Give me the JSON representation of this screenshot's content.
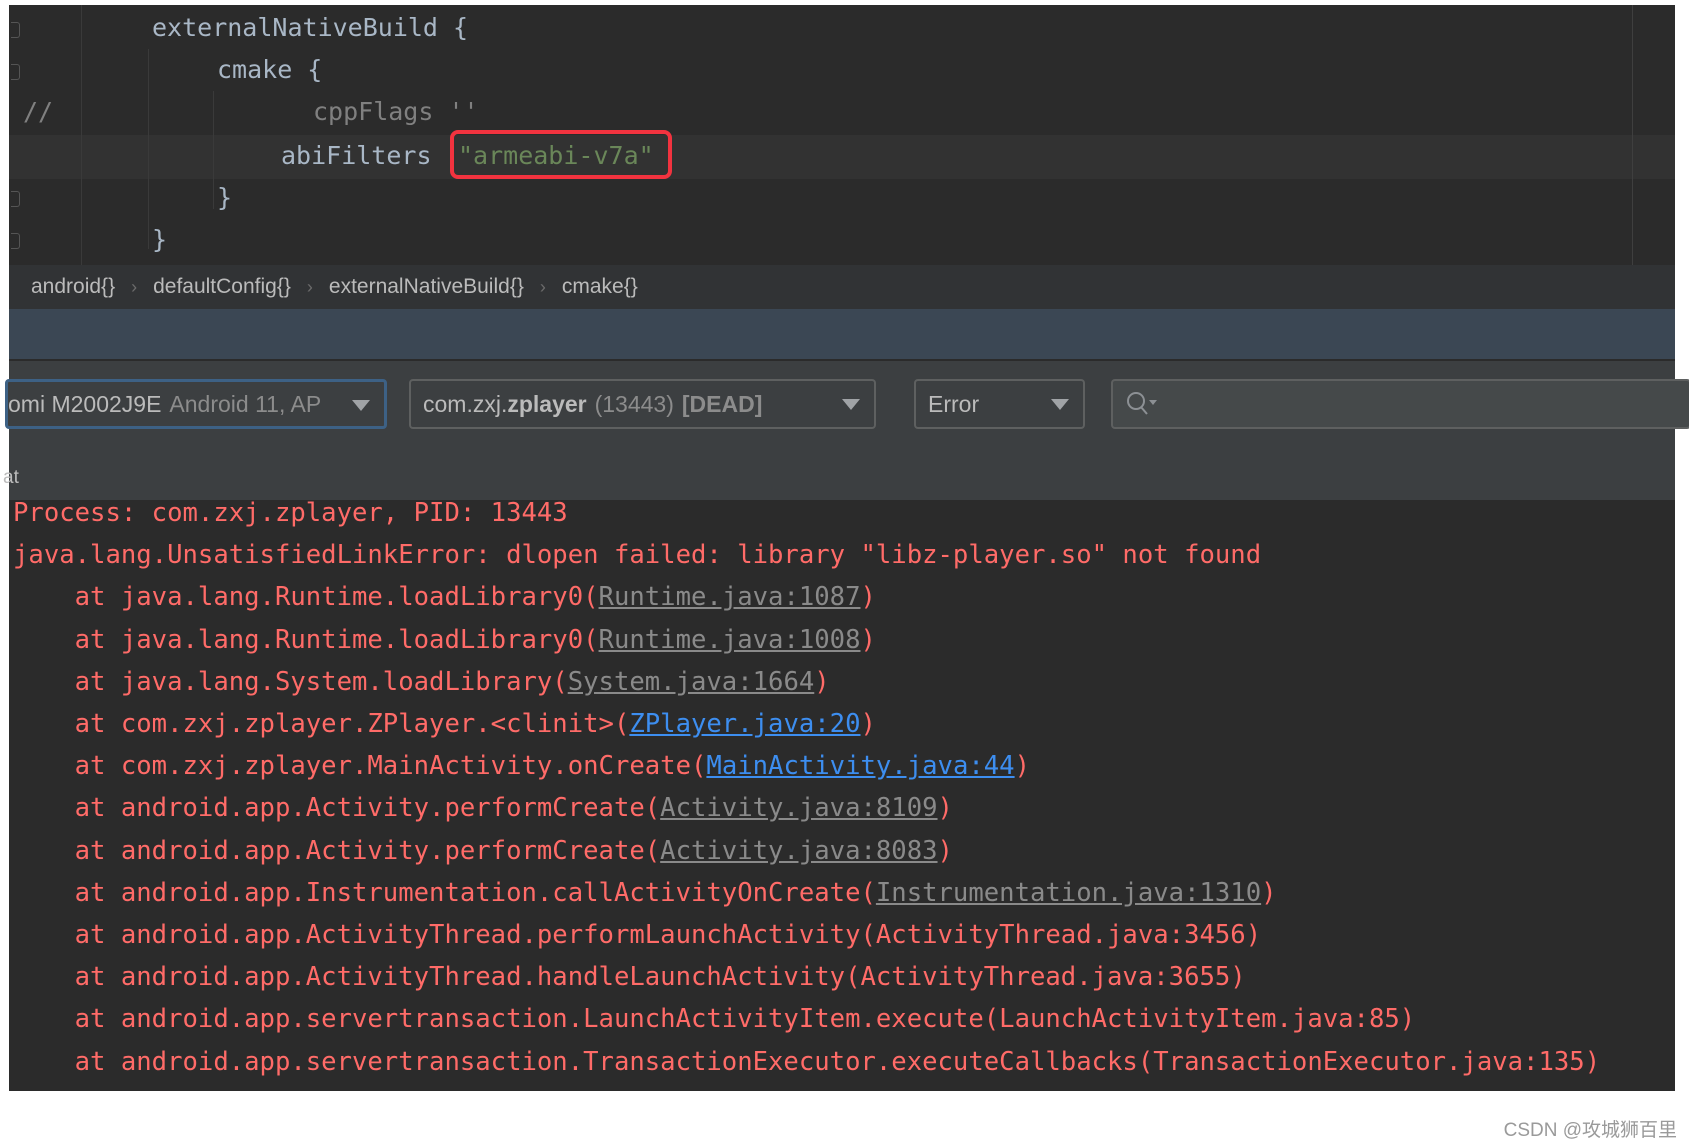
{
  "editor": {
    "lines": [
      {
        "text": "externalNativeBuild {"
      },
      {
        "text": "cmake {"
      },
      {
        "comment": "//",
        "text": "cppFlags ''"
      },
      {
        "text": "abiFilters ",
        "string": "\"armeabi-v7a\""
      },
      {
        "text": "}"
      },
      {
        "text": "}"
      }
    ],
    "highlight_color": "#f2333f"
  },
  "breadcrumb": [
    "android{}",
    "defaultConfig{}",
    "externalNativeBuild{}",
    "cmake{}"
  ],
  "toolbar": {
    "device": {
      "name": "omi M2002J9E",
      "detail": "Android 11, AP"
    },
    "process": {
      "package_prefix": "com.zxj.",
      "package_name": "zplayer",
      "pid": "(13443)",
      "state": "[DEAD]"
    },
    "level": "Error",
    "search": {
      "value": "",
      "icon": "search-icon"
    },
    "tab_label": "at"
  },
  "log": [
    {
      "pre": "Process: com.zxj.zplayer, PID: 13443"
    },
    {
      "pre": "java.lang.UnsatisfiedLinkError: dlopen failed: library \"libz-player.so\" not found"
    },
    {
      "pre": "    at java.lang.Runtime.loadLibrary0(",
      "link": "Runtime.java:1087",
      "kind": "grey",
      "post": ")"
    },
    {
      "pre": "    at java.lang.Runtime.loadLibrary0(",
      "link": "Runtime.java:1008",
      "kind": "grey",
      "post": ")"
    },
    {
      "pre": "    at java.lang.System.loadLibrary(",
      "link": "System.java:1664",
      "kind": "grey",
      "post": ")"
    },
    {
      "pre": "    at com.zxj.zplayer.ZPlayer.<clinit>(",
      "link": "ZPlayer.java:20",
      "kind": "blue",
      "post": ")"
    },
    {
      "pre": "    at com.zxj.zplayer.MainActivity.onCreate(",
      "link": "MainActivity.java:44",
      "kind": "blue",
      "post": ")"
    },
    {
      "pre": "    at android.app.Activity.performCreate(",
      "link": "Activity.java:8109",
      "kind": "grey",
      "post": ")"
    },
    {
      "pre": "    at android.app.Activity.performCreate(",
      "link": "Activity.java:8083",
      "kind": "grey",
      "post": ")"
    },
    {
      "pre": "    at android.app.Instrumentation.callActivityOnCreate(",
      "link": "Instrumentation.java:1310",
      "kind": "grey",
      "post": ")"
    },
    {
      "pre": "    at android.app.ActivityThread.performLaunchActivity(ActivityThread.java:3456)"
    },
    {
      "pre": "    at android.app.ActivityThread.handleLaunchActivity(ActivityThread.java:3655)"
    },
    {
      "pre": "    at android.app.servertransaction.LaunchActivityItem.execute(LaunchActivityItem.java:85)"
    },
    {
      "pre": "    at android.app.servertransaction.TransactionExecutor.executeCallbacks(TransactionExecutor.java:135)"
    }
  ],
  "colors": {
    "error_text": "#ff6b68",
    "link_blue": "#3d8ef0",
    "link_grey": "#8a8a8a",
    "string": "#6a8759"
  },
  "watermark": "CSDN @攻城狮百里"
}
